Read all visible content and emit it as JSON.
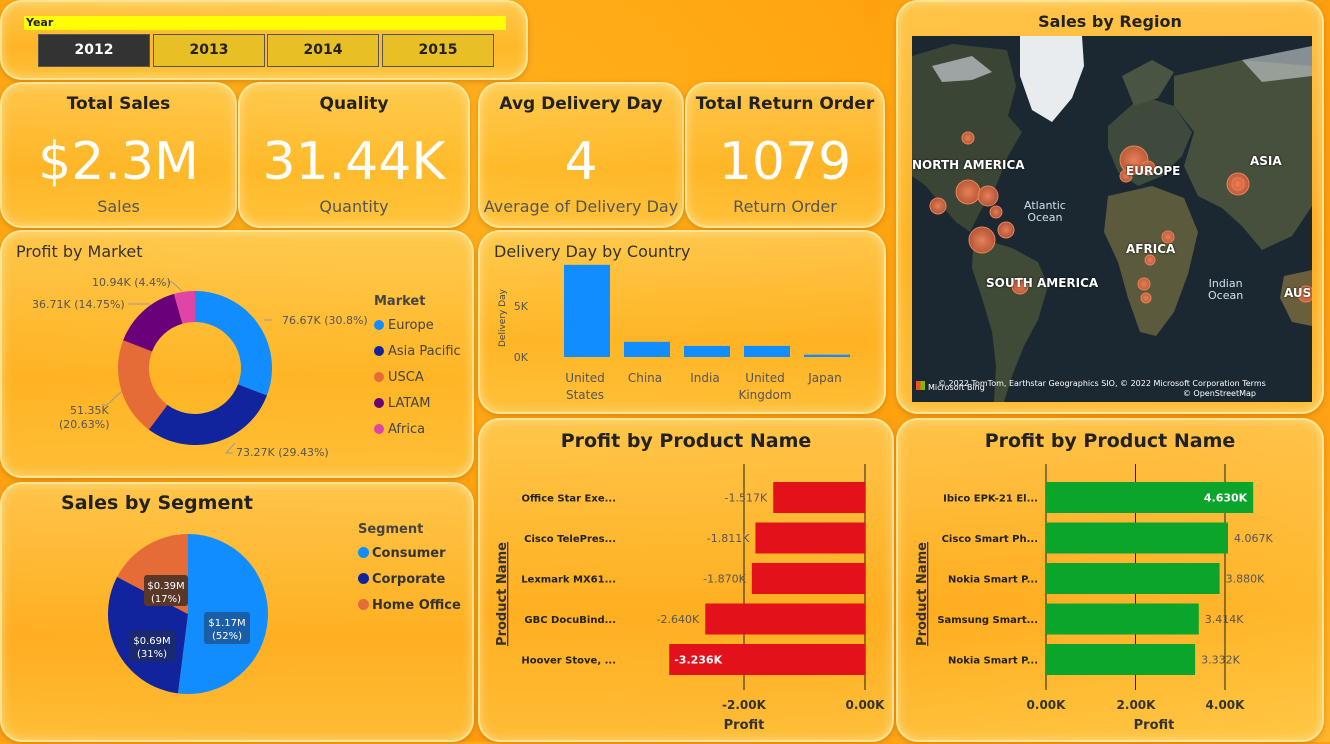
{
  "slicer": {
    "label": "Year",
    "options": [
      "2012",
      "2013",
      "2014",
      "2015"
    ],
    "selected": "2012"
  },
  "kpis": [
    {
      "title": "Total Sales",
      "value": "$2.3M",
      "sub": "Sales"
    },
    {
      "title": "Quality",
      "value": "31.44K",
      "sub": "Quantity"
    },
    {
      "title": "Avg Delivery Day",
      "value": "4",
      "sub": "Average of Delivery Day"
    },
    {
      "title": "Total Return Order",
      "value": "1079",
      "sub": "Return Order"
    }
  ],
  "profit_by_market": {
    "title": "Profit by Market",
    "legend_title": "Market",
    "labels": {
      "europe": "76.67K (30.8%)",
      "asia": "73.27K (29.43%)",
      "usca_1": "51.35K",
      "usca_2": "(20.63%)",
      "latam": "36.71K (14.75%)",
      "africa": "10.94K (4.4%)"
    }
  },
  "delivery_by_country": {
    "title": "Delivery Day by Country",
    "ylabel": "Delivery Day",
    "ticks": [
      "5K",
      "0K"
    ],
    "xlabels": [
      [
        "United",
        "States"
      ],
      [
        "China"
      ],
      [
        "India"
      ],
      [
        "United",
        "Kingdom"
      ],
      [
        "Japan"
      ]
    ]
  },
  "sales_by_region": {
    "title": "Sales by Region",
    "labels": [
      "NORTH AMERICA",
      "EUROPE",
      "ASIA",
      "AFRICA",
      "SOUTH AMERICA",
      "AUS"
    ],
    "oceans": [
      [
        "Atlantic",
        "Ocean"
      ],
      [
        "Indian",
        "Ocean"
      ]
    ],
    "copyright": "© 2022 TomTom, Earthstar Geographics SIO, © 2022 Microsoft Corporation  Terms",
    "osm": "© OpenStreetMap",
    "brand": "Microsoft Bing"
  },
  "sales_by_segment": {
    "title": "Sales by Segment",
    "legend_title": "Segment",
    "labels": {
      "consumer_value": "$1.17M",
      "consumer_pct": "(52%)",
      "corporate_value": "$0.69M",
      "corporate_pct": "(31%)",
      "home_value": "$0.39M",
      "home_pct": "(17%)"
    }
  },
  "profit_bottom": {
    "title": "Profit by Product Name",
    "ylabel": "Product Name",
    "xlabel": "Profit",
    "ticks": [
      "-2.00K",
      "0.00K"
    ],
    "value_labels": [
      "-1.517K",
      "-1.811K",
      "-1.870K",
      "-2.640K",
      "-3.236K"
    ]
  },
  "profit_top": {
    "title": "Profit by Product Name",
    "ylabel": "Product Name",
    "xlabel": "Profit",
    "ticks": [
      "0.00K",
      "2.00K",
      "4.00K"
    ],
    "value_labels": [
      "4.630K",
      "4.067K",
      "3.880K",
      "3.414K",
      "3.332K"
    ]
  },
  "chart_data": [
    {
      "type": "pie",
      "title": "Profit by Market",
      "legend_position": "right",
      "categories": [
        "Europe",
        "Asia Pacific",
        "USCA",
        "LATAM",
        "Africa"
      ],
      "values": [
        76.67,
        73.27,
        51.35,
        36.71,
        10.94
      ],
      "colors": [
        "#118dff",
        "#12239e",
        "#e66c37",
        "#6b007b",
        "#e044a7"
      ]
    },
    {
      "type": "bar",
      "title": "Delivery Day by Country",
      "ylabel": "Delivery Day",
      "categories": [
        "United States",
        "China",
        "India",
        "United Kingdom",
        "Japan"
      ],
      "values": [
        7900,
        1300,
        950,
        950,
        200
      ],
      "ylim": [
        0,
        9000
      ],
      "color": "#118dff"
    },
    {
      "type": "pie",
      "title": "Sales by Segment",
      "legend_position": "right",
      "categories": [
        "Consumer",
        "Corporate",
        "Home Office"
      ],
      "values": [
        1.17,
        0.69,
        0.39
      ],
      "colors": [
        "#118dff",
        "#12239e",
        "#e66c37"
      ]
    },
    {
      "type": "bar",
      "title": "Profit by Product Name",
      "orientation": "horizontal",
      "ylabel": "Product Name",
      "xlabel": "Profit",
      "categories": [
        "Office Star Exe...",
        "Cisco TelePres...",
        "Lexmark MX61...",
        "GBC DocuBind...",
        "Hoover Stove, ..."
      ],
      "values": [
        -1.517,
        -1.811,
        -1.87,
        -2.64,
        -3.236
      ],
      "xlim": [
        -3.236,
        0
      ],
      "color": "#e3111a"
    },
    {
      "type": "bar",
      "title": "Profit by Product Name",
      "orientation": "horizontal",
      "ylabel": "Product Name",
      "xlabel": "Profit",
      "categories": [
        "Ibico EPK-21 El...",
        "Cisco Smart Ph...",
        "Nokia Smart P...",
        "Samsung Smart...",
        "Nokia Smart P..."
      ],
      "values": [
        4.63,
        4.067,
        3.88,
        3.414,
        3.332
      ],
      "xlim": [
        0,
        4.63
      ],
      "color": "#0aa52a"
    }
  ]
}
